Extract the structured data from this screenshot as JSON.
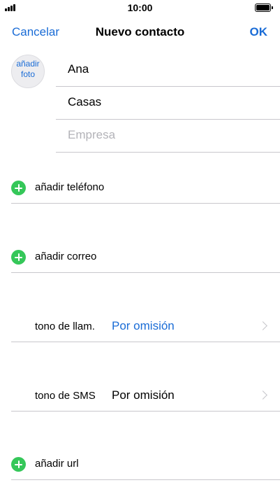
{
  "status_bar": {
    "time": "10:00"
  },
  "nav": {
    "cancel_label": "Cancelar",
    "title": "Nuevo contacto",
    "ok_label": "OK"
  },
  "photo": {
    "line1": "añadir",
    "line2": "foto"
  },
  "name_fields": {
    "first_name": "Ana",
    "last_name": "Casas",
    "company_placeholder": "Empresa"
  },
  "rows": {
    "add_phone": "añadir teléfono",
    "add_email": "añadir correo",
    "ringtone": {
      "label": "tono de llam.",
      "value": "Por omisión"
    },
    "text_tone": {
      "label": "tono de SMS",
      "value": "Por omisión"
    },
    "add_url": "añadir url"
  },
  "colors": {
    "accent": "#1a6cd6",
    "add_green": "#35c759",
    "separator": "#c8c7cc"
  },
  "icons": {
    "add": "plus-circle-icon",
    "chevron": "chevron-right-icon",
    "signal": "cellular-signal-icon",
    "battery": "battery-icon"
  }
}
